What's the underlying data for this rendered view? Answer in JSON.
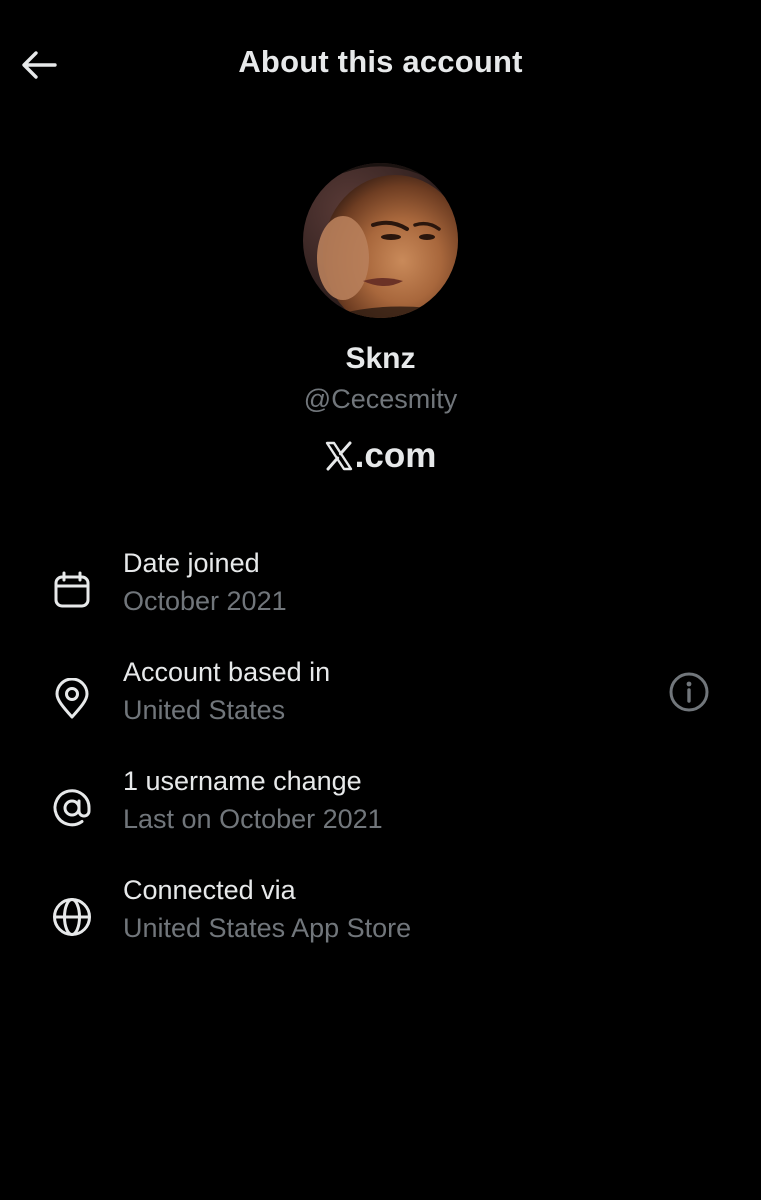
{
  "header": {
    "title": "About this account",
    "back_icon": "arrow-left-icon"
  },
  "profile": {
    "display_name": "Sknz",
    "handle": "@Cecesmity",
    "brand_suffix": ".com",
    "brand_logo": "x-logo"
  },
  "details": [
    {
      "icon": "calendar-icon",
      "label": "Date joined",
      "value": "October 2021"
    },
    {
      "icon": "location-pin-icon",
      "label": "Account based in",
      "value": "United States"
    },
    {
      "icon": "at-sign-icon",
      "label": "1 username change",
      "value": "Last on October 2021"
    },
    {
      "icon": "globe-icon",
      "label": "Connected via",
      "value": "United States App Store"
    }
  ],
  "colors": {
    "background": "#000000",
    "primary_text": "#e7e9ea",
    "secondary_text": "#71767b"
  }
}
